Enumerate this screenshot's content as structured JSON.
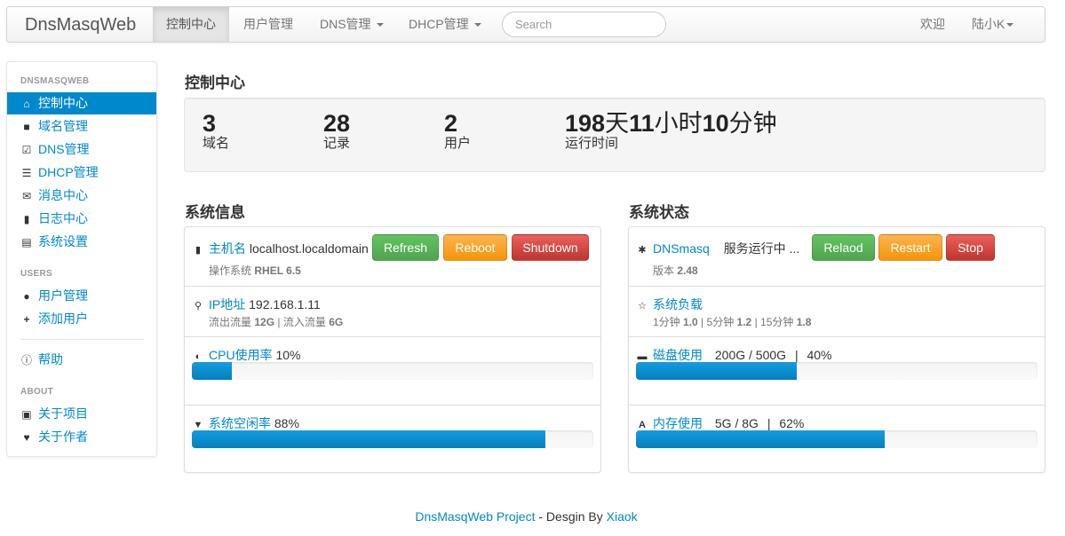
{
  "navbar": {
    "brand": "DnsMasqWeb",
    "items": [
      {
        "label": "控制中心",
        "active": true
      },
      {
        "label": "用户管理"
      },
      {
        "label": "DNS管理"
      },
      {
        "label": "DHCP管理"
      }
    ],
    "search_placeholder": "Search",
    "welcome": "欢迎",
    "user": "陆小K"
  },
  "sidebar": {
    "header1": "DNSMASQWEB",
    "items1": [
      "控制中心",
      "域名管理",
      "DNS管理",
      "DHCP管理",
      "消息中心",
      "日志中心",
      "系统设置"
    ],
    "header2": "USERS",
    "items2": [
      "用户管理",
      "添加用户"
    ],
    "help": "帮助",
    "header3": "ABOUT",
    "items3": [
      "关于项目",
      "关于作者"
    ]
  },
  "main": {
    "title": "控制中心",
    "stats": [
      {
        "value": "3",
        "label": "域名"
      },
      {
        "value": "28",
        "label": "记录"
      },
      {
        "value": "2",
        "label": "用户"
      }
    ],
    "uptime": {
      "days": "198",
      "d": "天",
      "hours": "11",
      "h": "小时",
      "mins": "10",
      "m": "分钟",
      "label": "运行时间"
    }
  },
  "sysinfo": {
    "title": "系统信息",
    "hostname_label": "主机名",
    "hostname": "localhost.localdomain",
    "os_label": "操作系统",
    "os": "RHEL 6.5",
    "btn_refresh": "Refresh",
    "btn_reboot": "Reboot",
    "btn_shutdown": "Shutdown",
    "ip_label": "IP地址",
    "ip": "192.168.1.11",
    "out_label": "流出流量",
    "out": "12G",
    "sep": "|",
    "in_label": "流入流量",
    "in": "6G",
    "cpu_label": "CPU使用率",
    "cpu_text": "10%",
    "cpu_pct": 10,
    "idle_label": "系统空闲率",
    "idle_text": "88%",
    "idle_pct": 88
  },
  "sysstatus": {
    "title": "系统状态",
    "service_label": "DNSmasq",
    "service_state": "服务运行中 ...",
    "version_label": "版本",
    "version": "2.48",
    "btn_reload": "Relaod",
    "btn_restart": "Restart",
    "btn_stop": "Stop",
    "load_label": "系统负载",
    "load1_label": "1分钟",
    "load1": "1.0",
    "load5_label": "5分钟",
    "load5": "1.2",
    "load15_label": "15分钟",
    "load15": "1.8",
    "disk_label": "磁盘使用",
    "disk_text": "200G / 500G",
    "disk_sep": "|",
    "disk_pct_text": "40%",
    "disk_pct": 40,
    "mem_label": "内存使用",
    "mem_text": "5G / 8G",
    "mem_sep": "|",
    "mem_pct_text": "62%",
    "mem_pct": 62
  },
  "footer": {
    "project": "DnsMasqWeb Project",
    "middle": " - Desgin By ",
    "author": "Xiaok"
  }
}
